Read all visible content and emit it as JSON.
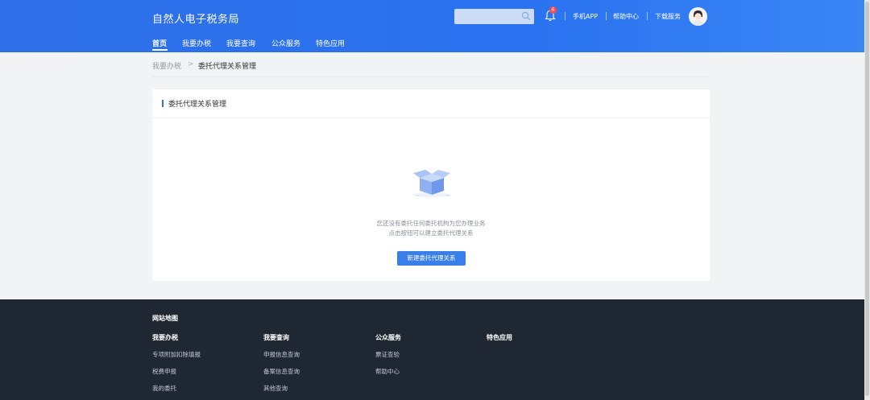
{
  "header": {
    "app_title": "自然人电子税务局",
    "search_placeholder": "",
    "notification_count": "6",
    "links": [
      "手机APP",
      "帮助中心",
      "下载服务"
    ],
    "nav": [
      "首页",
      "我要办税",
      "我要查询",
      "公众服务",
      "特色应用"
    ],
    "active_nav": "首页"
  },
  "breadcrumb": {
    "parent": "我要办税",
    "separator": ">",
    "current": "委托代理关系管理"
  },
  "card": {
    "title": "委托代理关系管理",
    "empty_line1": "您还没有委托任何委托机构为您办理业务",
    "empty_line2": "点击按钮可以建立委托代理关系",
    "button_label": "新建委托代理关系"
  },
  "footer": {
    "title": "网站地图",
    "columns": [
      {
        "heading": "我要办税",
        "links": [
          "专项附加扣除填报",
          "税费申报",
          "我的委托"
        ]
      },
      {
        "heading": "我要查询",
        "links": [
          "申报信息查询",
          "备案信息查询",
          "其他查询"
        ]
      },
      {
        "heading": "公众服务",
        "links": [
          "票证查验",
          "帮助中心"
        ]
      },
      {
        "heading": "特色应用",
        "links": []
      }
    ]
  },
  "colors": {
    "header_blue": "#2f6fe8",
    "button_blue": "#3a7ee8",
    "footer_bg": "#1f2733",
    "badge_red": "#ff4d4f"
  },
  "icons": [
    "search-icon",
    "bell-icon",
    "avatar-icon",
    "empty-box-icon",
    "chevron-right-icon"
  ]
}
